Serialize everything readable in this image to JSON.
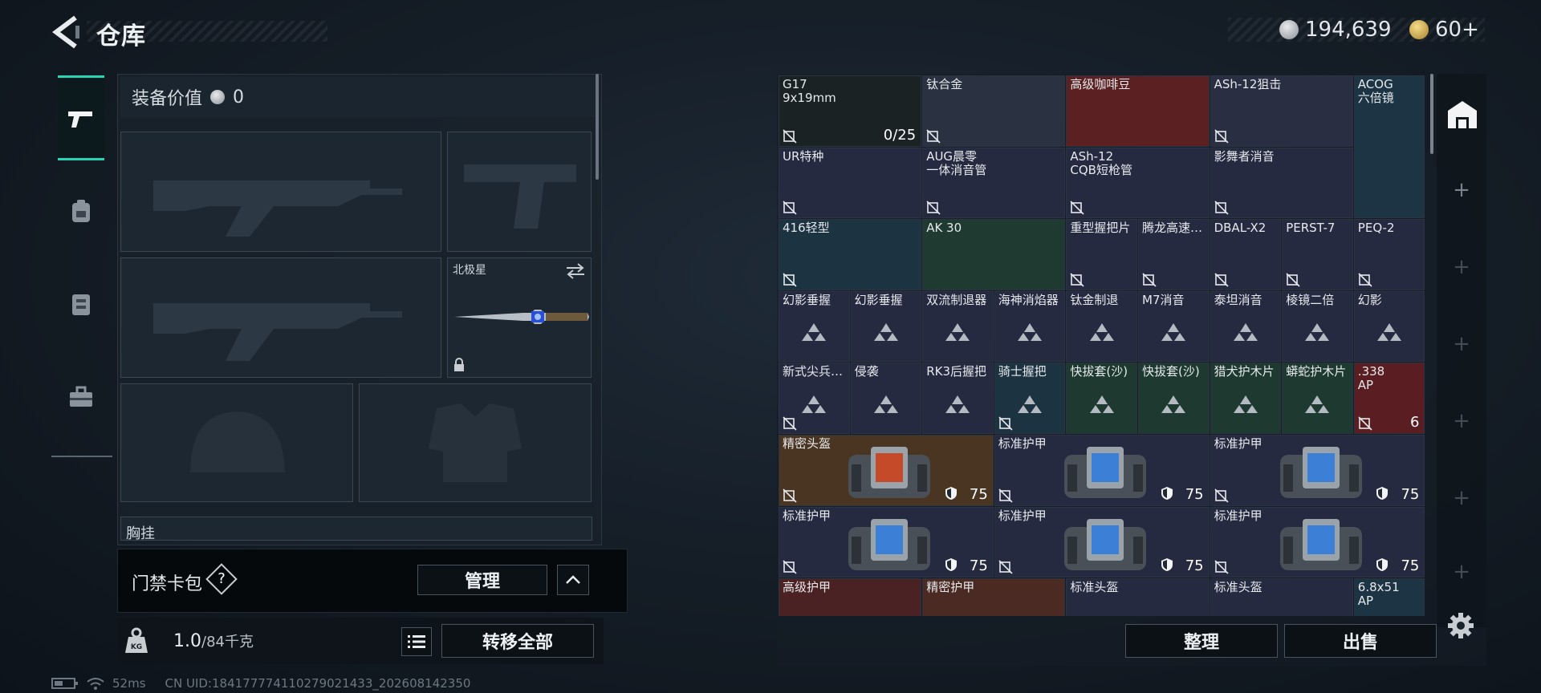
{
  "header": {
    "title": "仓库",
    "currency1": "194,639",
    "currency2": "60+"
  },
  "nav": [
    "weapons",
    "backpack",
    "armor",
    "case"
  ],
  "equip": {
    "value_label": "装备价值",
    "value": "0",
    "secondary_name": "北极星",
    "partial_label": "胸挂"
  },
  "keycard": {
    "label": "门禁卡包",
    "help": "?",
    "manage": "管理"
  },
  "weight": {
    "current": "1.0",
    "max": "/84千克",
    "transfer": "转移全部"
  },
  "status": {
    "ping": "52ms",
    "uid": "CN UID:18417777411027902143​3_202608142350"
  },
  "stash": {
    "cells": [
      {
        "name": "G17\n9x19mm",
        "count": "0/25",
        "color": "#1a2224"
      },
      {
        "name": "钛合金",
        "color": "#2a3242"
      },
      {
        "name": "高级咖啡豆",
        "color": "#5a2022"
      },
      {
        "name": "ASh-12狙击",
        "color": "#2a2e42"
      },
      {
        "name": "ACOG\n六倍镜",
        "color": "#1d3444"
      },
      {
        "name": "UR特种",
        "color": "#262a40"
      },
      {
        "name": "AUG晨零\n一体消音管",
        "color": "#262a40"
      },
      {
        "name": "ASh-12\nCQB短枪管",
        "color": "#262a40"
      },
      {
        "name": "影舞者消音",
        "color": "#262a40"
      },
      {
        "name": "416轻型",
        "color": "#1c3342"
      },
      {
        "name": "AK 30",
        "color": "#1f3a30"
      },
      {
        "name": "重型握把片",
        "color": "#262a40"
      },
      {
        "name": "腾龙高速…",
        "color": "#262a40"
      },
      {
        "name": "DBAL-X2",
        "color": "#262a40"
      },
      {
        "name": "PERST-7",
        "color": "#262a40"
      },
      {
        "name": "PEQ-2",
        "color": "#262a40"
      },
      {
        "name": "幻影垂握",
        "color": "#262a40"
      },
      {
        "name": "幻影垂握",
        "color": "#262a40"
      },
      {
        "name": "双流制退器",
        "color": "#262a40"
      },
      {
        "name": "海神消焰器",
        "color": "#262a40"
      },
      {
        "name": "钛金制退",
        "color": "#262a40"
      },
      {
        "name": "M7消音",
        "color": "#262a40"
      },
      {
        "name": "泰坦消音",
        "color": "#262a40"
      },
      {
        "name": "棱镜二倍",
        "color": "#262a40"
      },
      {
        "name": "幻影",
        "color": "#262a40"
      },
      {
        "name": "新式尖兵…",
        "color": "#262a40"
      },
      {
        "name": "侵袭",
        "color": "#262a40"
      },
      {
        "name": "RK3后握把",
        "color": "#262a40"
      },
      {
        "name": "骑士握把",
        "color": "#1c3342"
      },
      {
        "name": "快拔套(沙)",
        "color": "#1e3a30"
      },
      {
        "name": "快拔套(沙)",
        "color": "#1e3a30"
      },
      {
        "name": "猎犬护木片",
        "color": "#1e3a30"
      },
      {
        "name": "蟒蛇护木片",
        "color": "#1e3a30"
      },
      {
        "name": ".338\nAP",
        "count": "6",
        "color": "#5a1e22"
      },
      {
        "name": "精密头盔",
        "count": "75",
        "color": "#4a3422"
      },
      {
        "name": "标准护甲",
        "count": "75",
        "color": "#262a40"
      },
      {
        "name": "标准护甲",
        "count": "75",
        "color": "#262a40"
      },
      {
        "name": "标准护甲",
        "count": "75",
        "color": "#262a40"
      },
      {
        "name": "标准护甲",
        "count": "75",
        "color": "#262a40"
      },
      {
        "name": "标准护甲",
        "count": "75",
        "color": "#262a40"
      },
      {
        "name": "高级护甲",
        "color": "#4a2224"
      },
      {
        "name": "精密护甲",
        "color": "#4a2a22"
      },
      {
        "name": "标准头盔",
        "color": "#262a40"
      },
      {
        "name": "标准头盔",
        "color": "#262a40"
      },
      {
        "name": "6.8x51\nAP",
        "color": "#1d3444"
      }
    ]
  },
  "actions": {
    "sort": "整理",
    "sell": "出售"
  }
}
